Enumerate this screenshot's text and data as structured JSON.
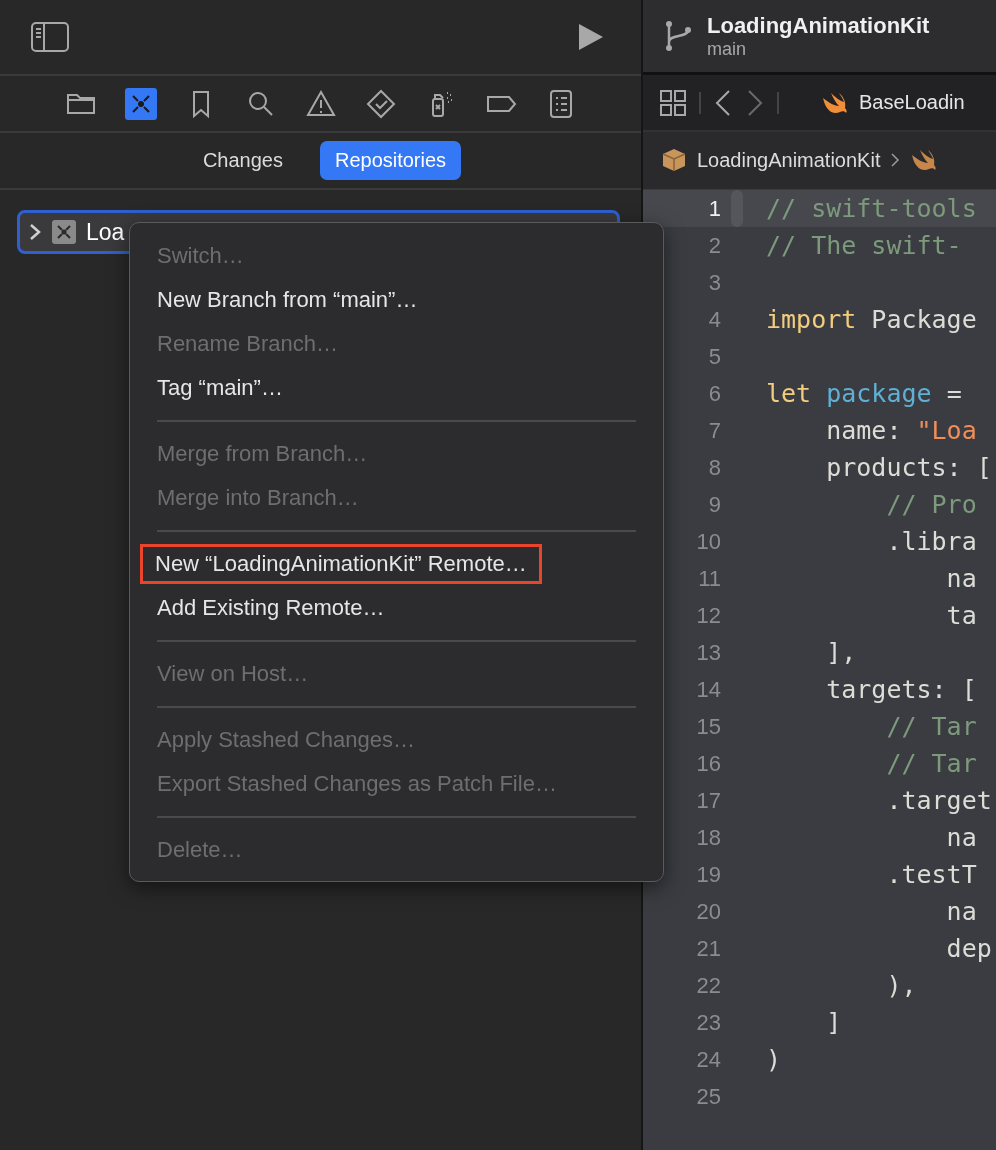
{
  "navigator": {
    "nav_icons": [
      {
        "kind": "folder",
        "selected": false
      },
      {
        "kind": "source-control",
        "selected": true
      },
      {
        "kind": "bookmark",
        "selected": false
      },
      {
        "kind": "search",
        "selected": false
      },
      {
        "kind": "warning",
        "selected": false
      },
      {
        "kind": "test",
        "selected": false
      },
      {
        "kind": "debug",
        "selected": false
      },
      {
        "kind": "tag",
        "selected": false
      },
      {
        "kind": "report",
        "selected": false
      }
    ],
    "scope_tabs": [
      {
        "label": "Changes",
        "selected": false
      },
      {
        "label": "Repositories",
        "selected": true
      }
    ],
    "repositories": [
      {
        "label": "Loa",
        "expanded": false,
        "selected": true
      }
    ]
  },
  "context_menu": {
    "items": [
      {
        "kind": "item",
        "label": "Switch…",
        "disabled": true,
        "outlined": false
      },
      {
        "kind": "item",
        "label": "New Branch from “main”…",
        "disabled": false,
        "outlined": false
      },
      {
        "kind": "item",
        "label": "Rename Branch…",
        "disabled": true,
        "outlined": false
      },
      {
        "kind": "item",
        "label": "Tag “main”…",
        "disabled": false,
        "outlined": false
      },
      {
        "kind": "separator"
      },
      {
        "kind": "item",
        "label": "Merge from Branch…",
        "disabled": true,
        "outlined": false
      },
      {
        "kind": "item",
        "label": "Merge into Branch…",
        "disabled": true,
        "outlined": false
      },
      {
        "kind": "separator"
      },
      {
        "kind": "item",
        "label": "New “LoadingAnimationKit” Remote…",
        "disabled": false,
        "outlined": true
      },
      {
        "kind": "item",
        "label": "Add Existing Remote…",
        "disabled": false,
        "outlined": false
      },
      {
        "kind": "separator"
      },
      {
        "kind": "item",
        "label": "View on Host…",
        "disabled": true,
        "outlined": false
      },
      {
        "kind": "separator"
      },
      {
        "kind": "item",
        "label": "Apply Stashed Changes…",
        "disabled": true,
        "outlined": false
      },
      {
        "kind": "item",
        "label": "Export Stashed Changes as Patch File…",
        "disabled": true,
        "outlined": false
      },
      {
        "kind": "separator"
      },
      {
        "kind": "item",
        "label": "Delete…",
        "disabled": true,
        "outlined": false
      }
    ]
  },
  "editor": {
    "repository": {
      "title": "LoadingAnimationKit",
      "branch": "main"
    },
    "tab": {
      "label": "BaseLoadin"
    },
    "breadcrumb": [
      {
        "label": "LoadingAnimationKit",
        "kind": "package"
      }
    ],
    "lines": [
      {
        "number": "1",
        "current": true,
        "tokens": [
          {
            "kind": "comment",
            "text": "// swift-tools"
          }
        ]
      },
      {
        "number": "2",
        "current": false,
        "tokens": [
          {
            "kind": "comment",
            "text": "// The swift-"
          }
        ]
      },
      {
        "number": "3",
        "current": false
      },
      {
        "number": "4",
        "current": false,
        "tokens": [
          {
            "kind": "keyword",
            "text": "import"
          },
          {
            "kind": "plain",
            "text": " Package"
          }
        ]
      },
      {
        "number": "5",
        "current": false
      },
      {
        "number": "6",
        "current": false,
        "tokens": [
          {
            "kind": "keyword",
            "text": "let "
          },
          {
            "kind": "declaration",
            "text": "package"
          },
          {
            "kind": "plain",
            "text": " ="
          }
        ]
      },
      {
        "number": "7",
        "current": false,
        "tokens": [
          {
            "kind": "plain",
            "text": "    name: "
          },
          {
            "kind": "string",
            "text": "\"Loa"
          }
        ]
      },
      {
        "number": "8",
        "current": false,
        "tokens": [
          {
            "kind": "plain",
            "text": "    products: ["
          }
        ]
      },
      {
        "number": "9",
        "current": false,
        "tokens": [
          {
            "kind": "comment",
            "text": "        // Pro"
          }
        ]
      },
      {
        "number": "10",
        "current": false,
        "tokens": [
          {
            "kind": "plain",
            "text": "        .libra"
          }
        ]
      },
      {
        "number": "11",
        "current": false,
        "tokens": [
          {
            "kind": "plain",
            "text": "            na"
          }
        ]
      },
      {
        "number": "12",
        "current": false,
        "tokens": [
          {
            "kind": "plain",
            "text": "            ta"
          }
        ]
      },
      {
        "number": "13",
        "current": false,
        "tokens": [
          {
            "kind": "plain",
            "text": "    ],"
          }
        ]
      },
      {
        "number": "14",
        "current": false,
        "tokens": [
          {
            "kind": "plain",
            "text": "    targets: ["
          }
        ]
      },
      {
        "number": "15",
        "current": false,
        "tokens": [
          {
            "kind": "comment",
            "text": "        // Tar"
          }
        ]
      },
      {
        "number": "16",
        "current": false,
        "tokens": [
          {
            "kind": "comment",
            "text": "        // Tar"
          }
        ]
      },
      {
        "number": "17",
        "current": false,
        "tokens": [
          {
            "kind": "plain",
            "text": "        .target"
          }
        ]
      },
      {
        "number": "18",
        "current": false,
        "tokens": [
          {
            "kind": "plain",
            "text": "            na"
          }
        ]
      },
      {
        "number": "19",
        "current": false,
        "tokens": [
          {
            "kind": "plain",
            "text": "        .testT"
          }
        ]
      },
      {
        "number": "20",
        "current": false,
        "tokens": [
          {
            "kind": "plain",
            "text": "            na"
          }
        ]
      },
      {
        "number": "21",
        "current": false,
        "tokens": [
          {
            "kind": "plain",
            "text": "            dep"
          }
        ]
      },
      {
        "number": "22",
        "current": false,
        "tokens": [
          {
            "kind": "plain",
            "text": "        ),"
          }
        ]
      },
      {
        "number": "23",
        "current": false,
        "tokens": [
          {
            "kind": "plain",
            "text": "    ]"
          }
        ]
      },
      {
        "number": "24",
        "current": false,
        "tokens": [
          {
            "kind": "plain",
            "text": ")"
          }
        ]
      },
      {
        "number": "25",
        "current": false
      }
    ]
  }
}
